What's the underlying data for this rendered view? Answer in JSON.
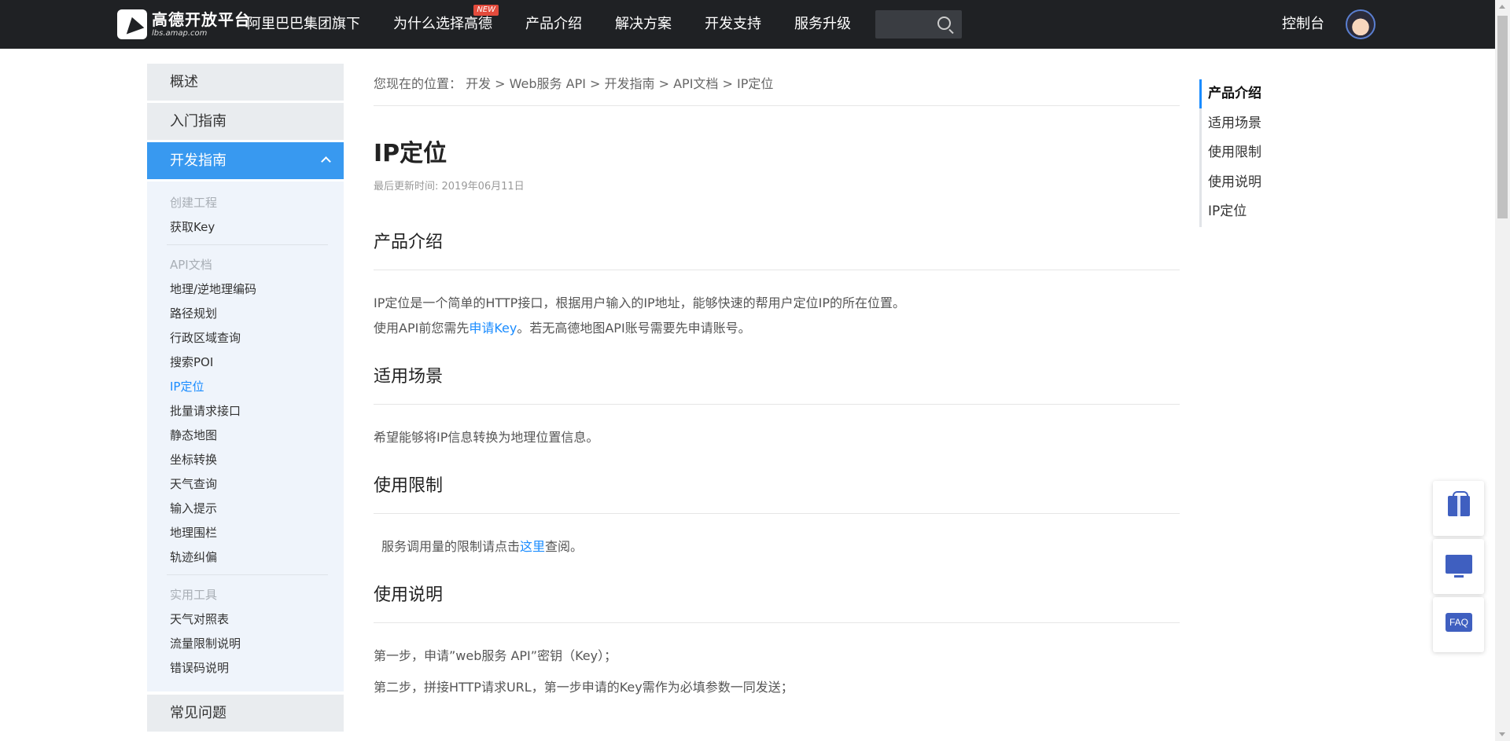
{
  "topbar": {
    "logo_name": "高德开放平台",
    "logo_url": "lbs.amap.com",
    "nav": [
      {
        "label": "阿里巴巴集团旗下"
      },
      {
        "label": "为什么选择高德",
        "badge": "NEW"
      },
      {
        "label": "产品介绍"
      },
      {
        "label": "解决方案"
      },
      {
        "label": "开发支持"
      },
      {
        "label": "服务升级"
      }
    ],
    "console_label": "控制台"
  },
  "sidebar": {
    "overview": "概述",
    "getting_started": "入门指南",
    "dev_guide": "开发指南",
    "sections": [
      {
        "head": "创建工程",
        "items": [
          "获取Key"
        ]
      },
      {
        "head": "API文档",
        "items": [
          "地理/逆地理编码",
          "路径规划",
          "行政区域查询",
          "搜索POI",
          "IP定位",
          "批量请求接口",
          "静态地图",
          "坐标转换",
          "天气查询",
          "输入提示",
          "地理围栏",
          "轨迹纠偏"
        ]
      },
      {
        "head": "实用工具",
        "items": [
          "天气对照表",
          "流量限制说明",
          "错误码说明"
        ]
      }
    ],
    "faq": "常见问题"
  },
  "main": {
    "breadcrumb": "您现在的位置： 开发 > Web服务 API > 开发指南 > API文档 > IP定位",
    "title": "IP定位",
    "updated": "最后更新时间: 2019年06月11日",
    "intro_title": "产品介绍",
    "intro_p1": "IP定位是一个简单的HTTP接口，根据用户输入的IP地址，能够快速的帮用户定位IP的所在位置。",
    "intro_p2_pre": "使用API前您需先",
    "intro_p2_link": "申请Key",
    "intro_p2_post": "。若无高德地图API账号需要先申请账号。",
    "scene_title": "适用场景",
    "scene_p": "希望能够将IP信息转换为地理位置信息。",
    "limit_title": "使用限制",
    "limit_pre": "服务调用量的限制请点击",
    "limit_link": "这里",
    "limit_post": "查阅。",
    "usage_title": "使用说明",
    "usage_p1": "第一步，申请”web服务 API”密钥（Key）；",
    "usage_p2": "第二步，拼接HTTP请求URL，第一步申请的Key需作为必填参数一同发送；"
  },
  "toc": [
    "产品介绍",
    "适用场景",
    "使用限制",
    "使用说明",
    "IP定位"
  ],
  "float": {
    "faq_label": "FAQ"
  },
  "colors": {
    "accent": "#3899f0",
    "link": "#1a8cff",
    "topbar": "#1f2124"
  }
}
